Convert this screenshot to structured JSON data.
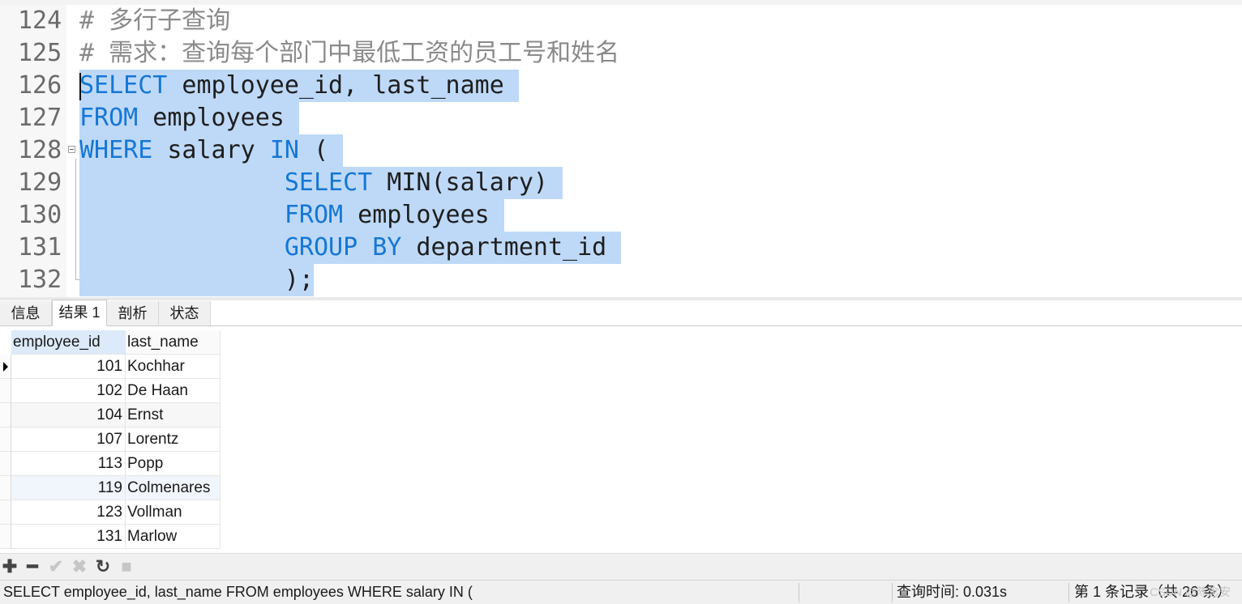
{
  "editor": {
    "lines": [
      {
        "num": "124",
        "tokens": [
          {
            "t": "# 多行子查询",
            "c": "cm"
          }
        ],
        "selected": false
      },
      {
        "num": "125",
        "tokens": [
          {
            "t": "# 需求：查询每个部门中最低工资的员工号和姓名",
            "c": "cm"
          }
        ],
        "selected": false
      },
      {
        "num": "126",
        "tokens": [
          {
            "t": "SELECT",
            "c": "kw"
          },
          {
            "t": " employee_id, last_name ",
            "c": ""
          }
        ],
        "selected": true
      },
      {
        "num": "127",
        "tokens": [
          {
            "t": "FROM",
            "c": "kw"
          },
          {
            "t": " employees ",
            "c": ""
          }
        ],
        "selected": true
      },
      {
        "num": "128",
        "tokens": [
          {
            "t": "WHERE",
            "c": "kw"
          },
          {
            "t": " salary ",
            "c": ""
          },
          {
            "t": "IN",
            "c": "kw"
          },
          {
            "t": " ( ",
            "c": ""
          }
        ],
        "selected": true
      },
      {
        "num": "129",
        "tokens": [
          {
            "t": "              ",
            "c": "ind"
          },
          {
            "t": "SELECT",
            "c": "kw"
          },
          {
            "t": " MIN(salary) ",
            "c": ""
          }
        ],
        "selected": true
      },
      {
        "num": "130",
        "tokens": [
          {
            "t": "              ",
            "c": "ind"
          },
          {
            "t": "FROM",
            "c": "kw"
          },
          {
            "t": " employees ",
            "c": ""
          }
        ],
        "selected": true
      },
      {
        "num": "131",
        "tokens": [
          {
            "t": "              ",
            "c": "ind"
          },
          {
            "t": "GROUP BY",
            "c": "kw"
          },
          {
            "t": " department_id ",
            "c": ""
          }
        ],
        "selected": true
      },
      {
        "num": "132",
        "tokens": [
          {
            "t": "              ",
            "c": "ind"
          },
          {
            "t": ");",
            "c": ""
          }
        ],
        "selected": true
      }
    ]
  },
  "tabs": [
    {
      "label": "信息",
      "active": false
    },
    {
      "label": "结果 1",
      "active": true
    },
    {
      "label": "剖析",
      "active": false
    },
    {
      "label": "状态",
      "active": false
    }
  ],
  "grid": {
    "columns": [
      "employee_id",
      "last_name"
    ],
    "rows": [
      {
        "employee_id": "101",
        "last_name": "Kochhar"
      },
      {
        "employee_id": "102",
        "last_name": "De Haan"
      },
      {
        "employee_id": "104",
        "last_name": "Ernst"
      },
      {
        "employee_id": "107",
        "last_name": "Lorentz"
      },
      {
        "employee_id": "113",
        "last_name": "Popp"
      },
      {
        "employee_id": "119",
        "last_name": "Colmenares"
      },
      {
        "employee_id": "123",
        "last_name": "Vollman"
      },
      {
        "employee_id": "131",
        "last_name": "Marlow"
      }
    ]
  },
  "toolbar": {
    "add_glyph": "✚",
    "remove_glyph": "━",
    "apply_glyph": "✔",
    "discard_glyph": "✖",
    "refresh_glyph": "↻",
    "stop_glyph": "■"
  },
  "status": {
    "query_text": "SELECT employee_id, last_name  FROM employees  WHERE salary IN (",
    "query_time": "查询时间: 0.031s",
    "record_info": "第 1 条记录（共 26 条）",
    "watermark": "CSDN @陈念安"
  },
  "colors": {
    "keyword": "#1577d6",
    "comment": "#8a8a8a",
    "selection": "#bed9f7"
  }
}
